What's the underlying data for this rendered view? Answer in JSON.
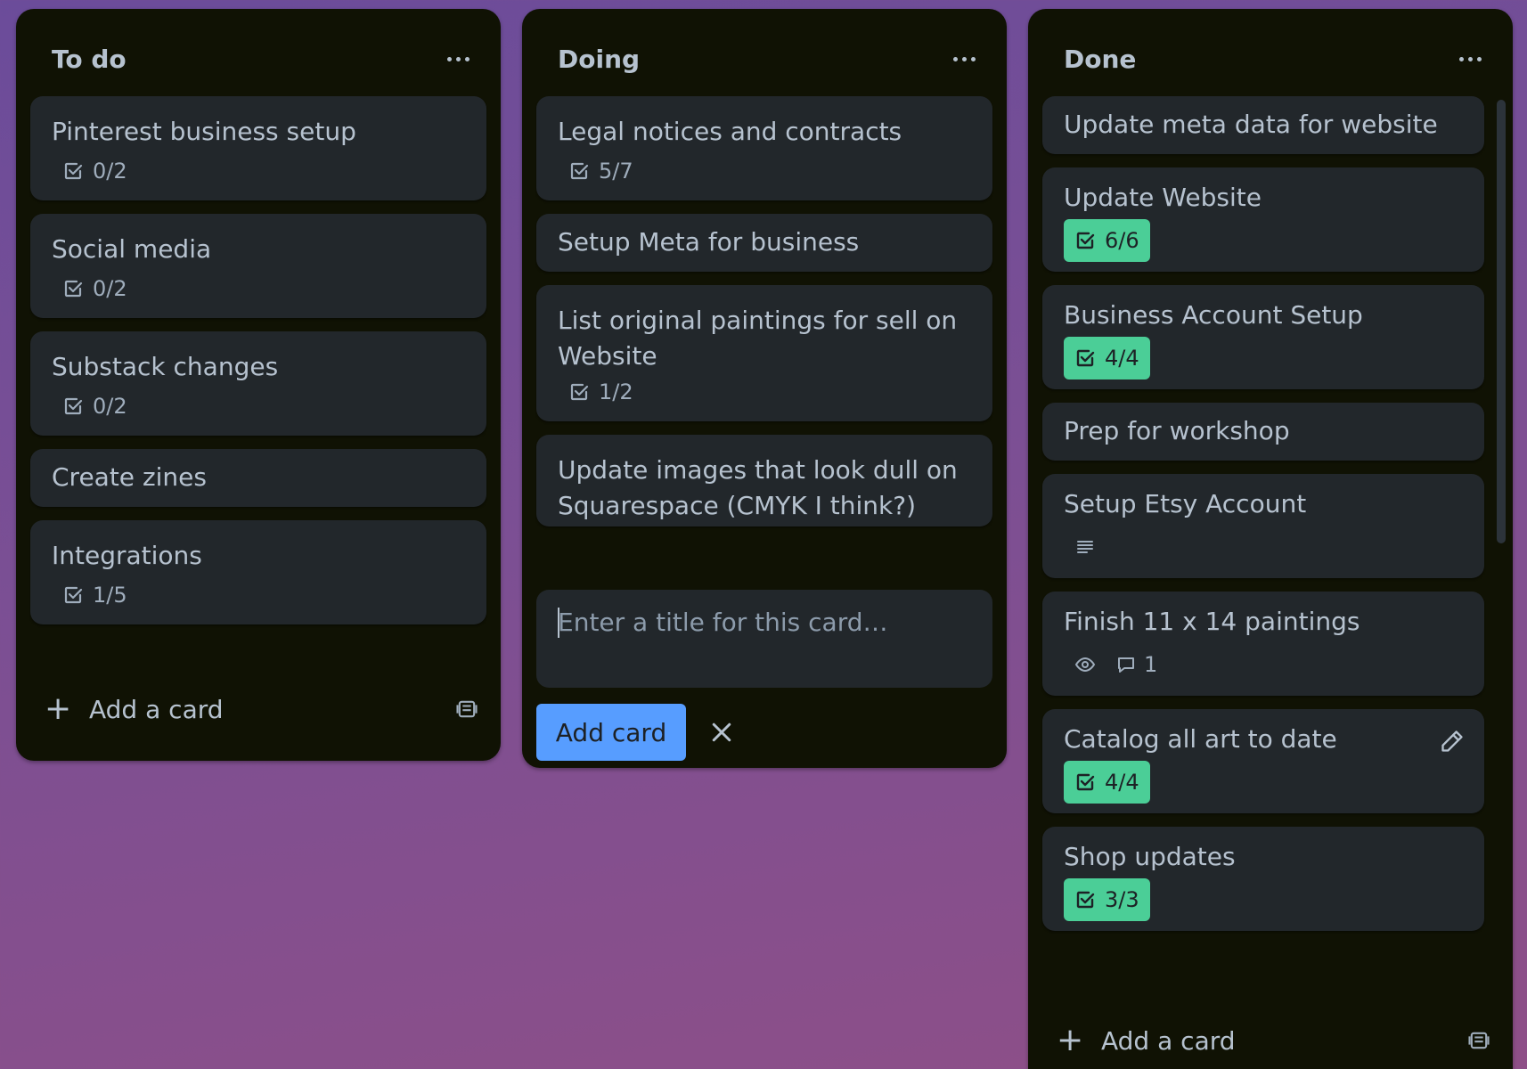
{
  "lists": [
    {
      "title": "To do",
      "cards": [
        {
          "title": "Pinterest business setup",
          "checklist": "0/2"
        },
        {
          "title": "Social media",
          "checklist": "0/2"
        },
        {
          "title": "Substack changes",
          "checklist": "0/2"
        },
        {
          "title": "Create zines"
        },
        {
          "title": "Integrations",
          "checklist": "1/5"
        }
      ],
      "add_card_label": "Add a card"
    },
    {
      "title": "Doing",
      "cards": [
        {
          "title": "Legal notices and contracts",
          "checklist": "5/7"
        },
        {
          "title": "Setup Meta for business"
        },
        {
          "title": "List original paintings for sell on Website",
          "checklist": "1/2"
        },
        {
          "title": "Update images that look dull on Squarespace (CMYK I think?)"
        }
      ],
      "composer_placeholder": "Enter a title for this card…",
      "add_card_button": "Add card"
    },
    {
      "title": "Done",
      "cards": [
        {
          "title": "Update meta data for website"
        },
        {
          "title": "Update Website",
          "checklist": "6/6",
          "complete": true
        },
        {
          "title": "Business Account Setup",
          "checklist": "4/4",
          "complete": true
        },
        {
          "title": "Prep for workshop"
        },
        {
          "title": "Setup Etsy Account",
          "has_description": true
        },
        {
          "title": "Finish 11 x 14 paintings",
          "watching": true,
          "comments": "1"
        },
        {
          "title": "Catalog all art to date",
          "checklist": "4/4",
          "complete": true
        },
        {
          "title": "Shop updates",
          "checklist": "3/3",
          "complete": true
        }
      ],
      "add_card_label": "Add a card"
    }
  ],
  "colors": {
    "list_bg": "#101204",
    "card_bg": "#22272b",
    "text": "#b6c2cf",
    "complete_badge": "#4bce97",
    "primary_button": "#579dff"
  },
  "icons": [
    "ellipsis-icon",
    "checklist-icon",
    "plus-icon",
    "template-icon",
    "close-icon",
    "description-icon",
    "eye-icon",
    "comment-icon",
    "pencil-icon"
  ]
}
